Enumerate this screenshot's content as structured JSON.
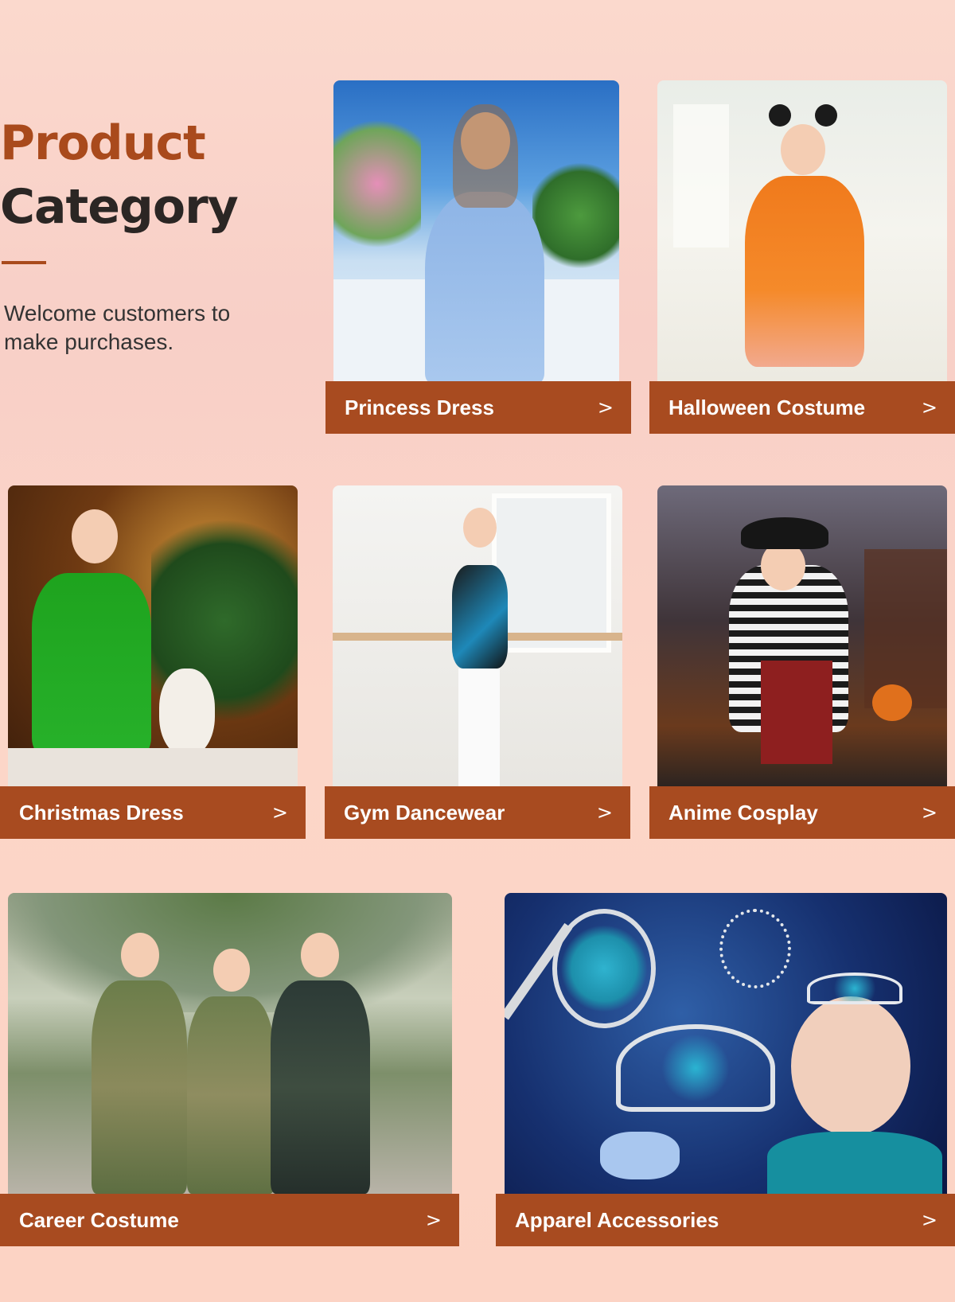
{
  "heading": {
    "title_line1": "Product",
    "title_line2": "Category",
    "subtitle": "Welcome customers to make purchases."
  },
  "cards": [
    {
      "label": "Princess Dress",
      "chevron": ">"
    },
    {
      "label": "Halloween Costume",
      "chevron": ">"
    },
    {
      "label": "Christmas Dress",
      "chevron": ">"
    },
    {
      "label": "Gym Dancewear",
      "chevron": ">"
    },
    {
      "label": "Anime Cosplay",
      "chevron": ">"
    },
    {
      "label": "Career Costume",
      "chevron": ">"
    },
    {
      "label": "Apparel Accessories",
      "chevron": ">"
    }
  ],
  "colors": {
    "accent": "#a84b20",
    "title_dark": "#2b2624",
    "background": "#fbd5c8"
  }
}
